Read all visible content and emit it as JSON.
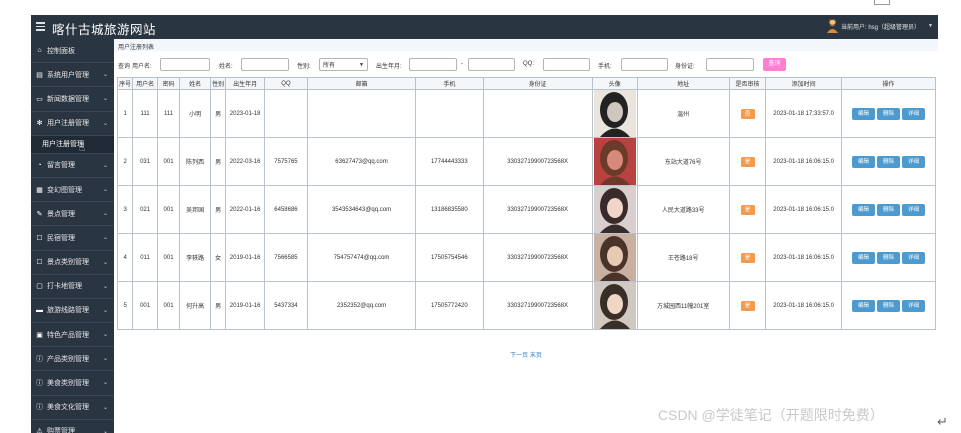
{
  "app": {
    "title": "喀什古城旅游网站",
    "user": "当前用户: hsg（超级管理员）"
  },
  "sidebar": {
    "items": [
      {
        "label": "控制面板",
        "icon": "home-icon",
        "chev": false
      },
      {
        "label": "系统用户管理",
        "icon": "document-icon",
        "chev": true
      },
      {
        "label": "新闻数据管理",
        "icon": "monitor-icon",
        "chev": true
      },
      {
        "label": "用户注册管理",
        "icon": "gear-icon",
        "chev": true
      }
    ],
    "submenu": "用户注册管理",
    "items2": [
      {
        "label": "留言管理",
        "icon": "pie-icon",
        "chev": true
      },
      {
        "label": "变幻图管理",
        "icon": "image-icon",
        "chev": true
      },
      {
        "label": "景点管理",
        "icon": "pen-icon",
        "chev": true
      },
      {
        "label": "民宿管理",
        "icon": "edit-icon",
        "chev": true
      },
      {
        "label": "景点类别管理",
        "icon": "edit-icon",
        "chev": true
      },
      {
        "label": "打卡地管理",
        "icon": "comment-icon",
        "chev": true
      },
      {
        "label": "旅游线路管理",
        "icon": "folder-icon",
        "chev": true
      },
      {
        "label": "特色产品管理",
        "icon": "calendar-icon",
        "chev": true
      },
      {
        "label": "产品类别管理",
        "icon": "info-icon",
        "chev": true
      },
      {
        "label": "美食类别管理",
        "icon": "info-icon",
        "chev": true
      },
      {
        "label": "美食文化管理",
        "icon": "info-icon",
        "chev": true
      },
      {
        "label": "购票管理",
        "icon": "warning-icon",
        "chev": true
      }
    ]
  },
  "breadcrumb": "用户注册列表",
  "search": {
    "query_label": "查询",
    "username_label": "用户名:",
    "name_label": "姓名:",
    "gender_label": "性别:",
    "gender_value": "所有",
    "birth_label": "出生年月:",
    "dash": "-",
    "qq_label": "QQ:",
    "phone_label": "手机:",
    "idcard_label": "身份证:",
    "button": "查询"
  },
  "table": {
    "headers": [
      "序号",
      "用户名",
      "密码",
      "姓名",
      "性别",
      "出生年月",
      "QQ",
      "邮箱",
      "手机",
      "身份证",
      "头像",
      "地址",
      "是否审核",
      "添加时间",
      "操作"
    ],
    "rows": [
      [
        "1",
        "111",
        "111",
        "小明",
        "男",
        "2023-01-18",
        "",
        "",
        "",
        "",
        "",
        "温州",
        "否",
        "2023-01-18 17:33:57.0"
      ],
      [
        "2",
        "031",
        "001",
        "陈列西",
        "男",
        "2022-03-16",
        "7575765",
        "63627473@qq.com",
        "17744443333",
        "330327199007235​68X",
        "",
        "东站大道76号",
        "是",
        "2023-01-18 16:06:15.0"
      ],
      [
        "3",
        "021",
        "001",
        "吴邦国",
        "男",
        "2022-01-16",
        "6458686",
        "3543534643@qq.com",
        "13186835580",
        "33032719900723568X",
        "",
        "人民大道路33号",
        "是",
        "2023-01-18 16:06:15.0"
      ],
      [
        "4",
        "011",
        "001",
        "李轶路",
        "女",
        "2019-01-16",
        "7566585",
        "754757474@qq.com",
        "17505754546",
        "33032719900723568X",
        "",
        "王苍路18号",
        "是",
        "2023-01-18 16:06:15.0"
      ],
      [
        "5",
        "001",
        "001",
        "何升高",
        "男",
        "2019-01-16",
        "5437334",
        "2352352@qq.com",
        "17505772420",
        "33032719900723568X",
        "",
        "方城园西11幢201室",
        "是",
        "2023-01-18 16:06:15.0"
      ]
    ],
    "ops": [
      "编辑",
      "删除",
      "详细"
    ]
  },
  "pager": "下一页 末页",
  "watermark": "CSDN @学徒笔记（开题限时免费）",
  "colors": {
    "dark": "#2a3542",
    "op_button": "#4b9bd1",
    "audit": "#f39c4f",
    "query_button": "#ff7fd1"
  }
}
